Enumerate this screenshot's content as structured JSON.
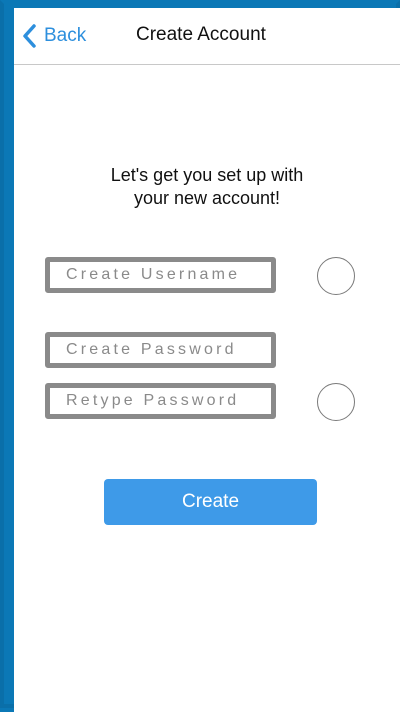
{
  "navbar": {
    "back_label": "Back",
    "title": "Create Account"
  },
  "intro": {
    "line1": "Let's get you set up with",
    "line2": "your new account!"
  },
  "form": {
    "username_placeholder": "Create Username",
    "password_placeholder": "Create Password",
    "retype_placeholder": "Retype Password",
    "create_label": "Create"
  },
  "icons": {
    "back": "chevron-left-icon",
    "username_status": "empty-circle-indicator",
    "password_status": "empty-circle-indicator"
  },
  "colors": {
    "frame": "#0b78b6",
    "accent": "#2d8fdd",
    "button": "#3e9ae8",
    "field_border": "#8a8a8a"
  }
}
